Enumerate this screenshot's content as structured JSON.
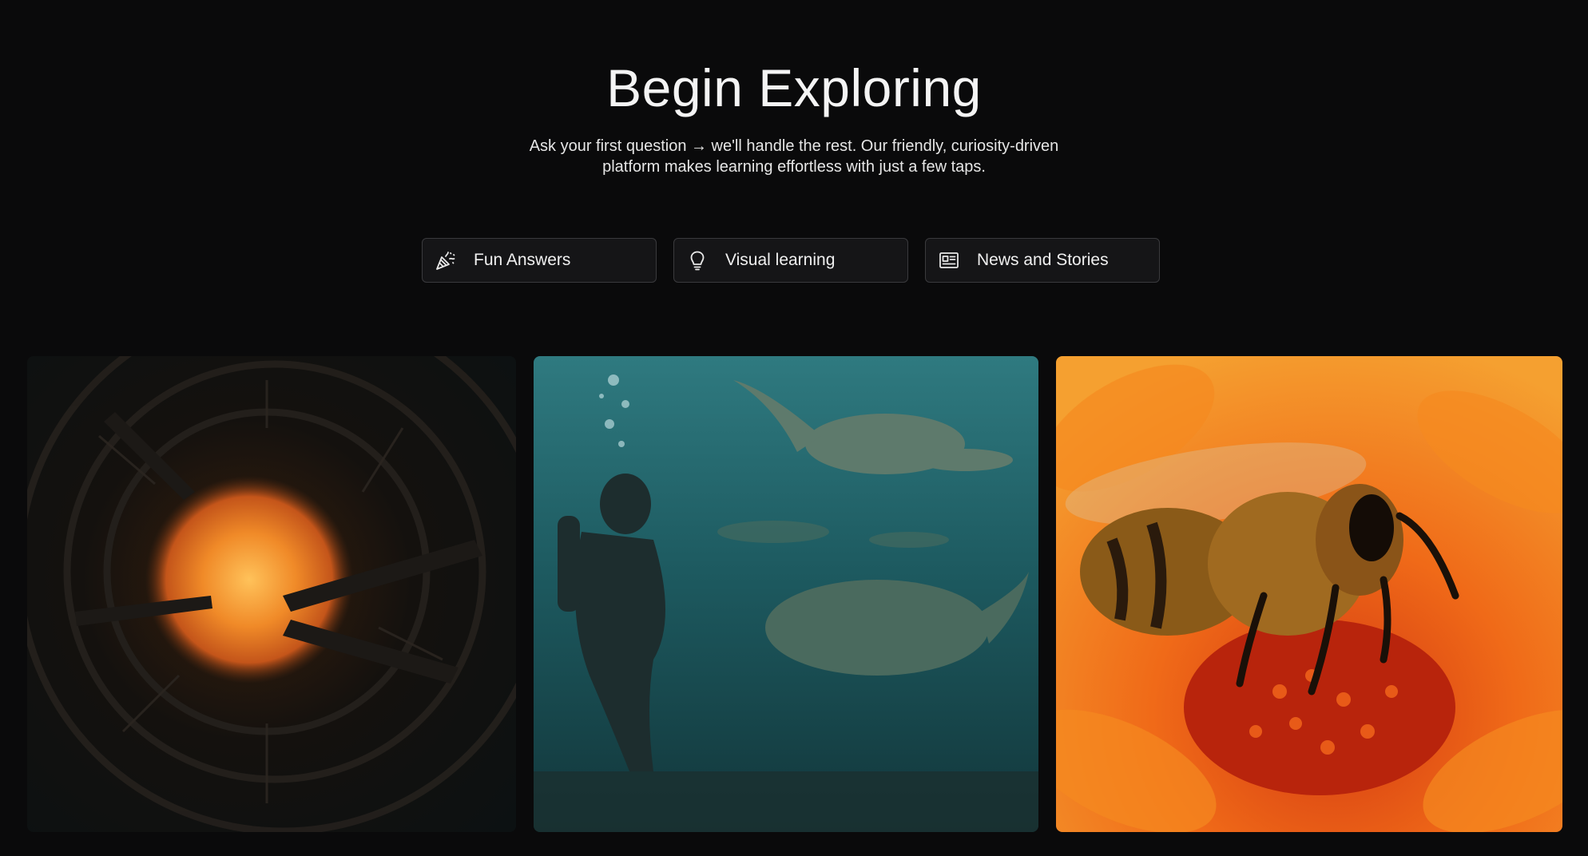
{
  "hero": {
    "title": "Begin Exploring",
    "subtitle_line1": "Ask your first question → we'll handle the rest. Our friendly, curiosity-driven",
    "subtitle_line2": "platform makes learning effortless with just a few taps."
  },
  "chips": [
    {
      "label": "Fun Answers",
      "icon": "party-popper-icon"
    },
    {
      "label": "Visual learning",
      "icon": "lightbulb-icon"
    },
    {
      "label": "News and Stories",
      "icon": "newspaper-icon"
    }
  ],
  "gallery": [
    {
      "subject": "space-station-around-sun",
      "icon": "sun-ring-image"
    },
    {
      "subject": "diver-with-sea-reptiles",
      "icon": "underwater-image"
    },
    {
      "subject": "bee-on-orange-flower",
      "icon": "bee-flower-image"
    }
  ],
  "colors": {
    "background": "#0a0a0b",
    "chip_background": "#151517",
    "chip_border": "#3a3a3d",
    "text": "#f2f2f2"
  }
}
